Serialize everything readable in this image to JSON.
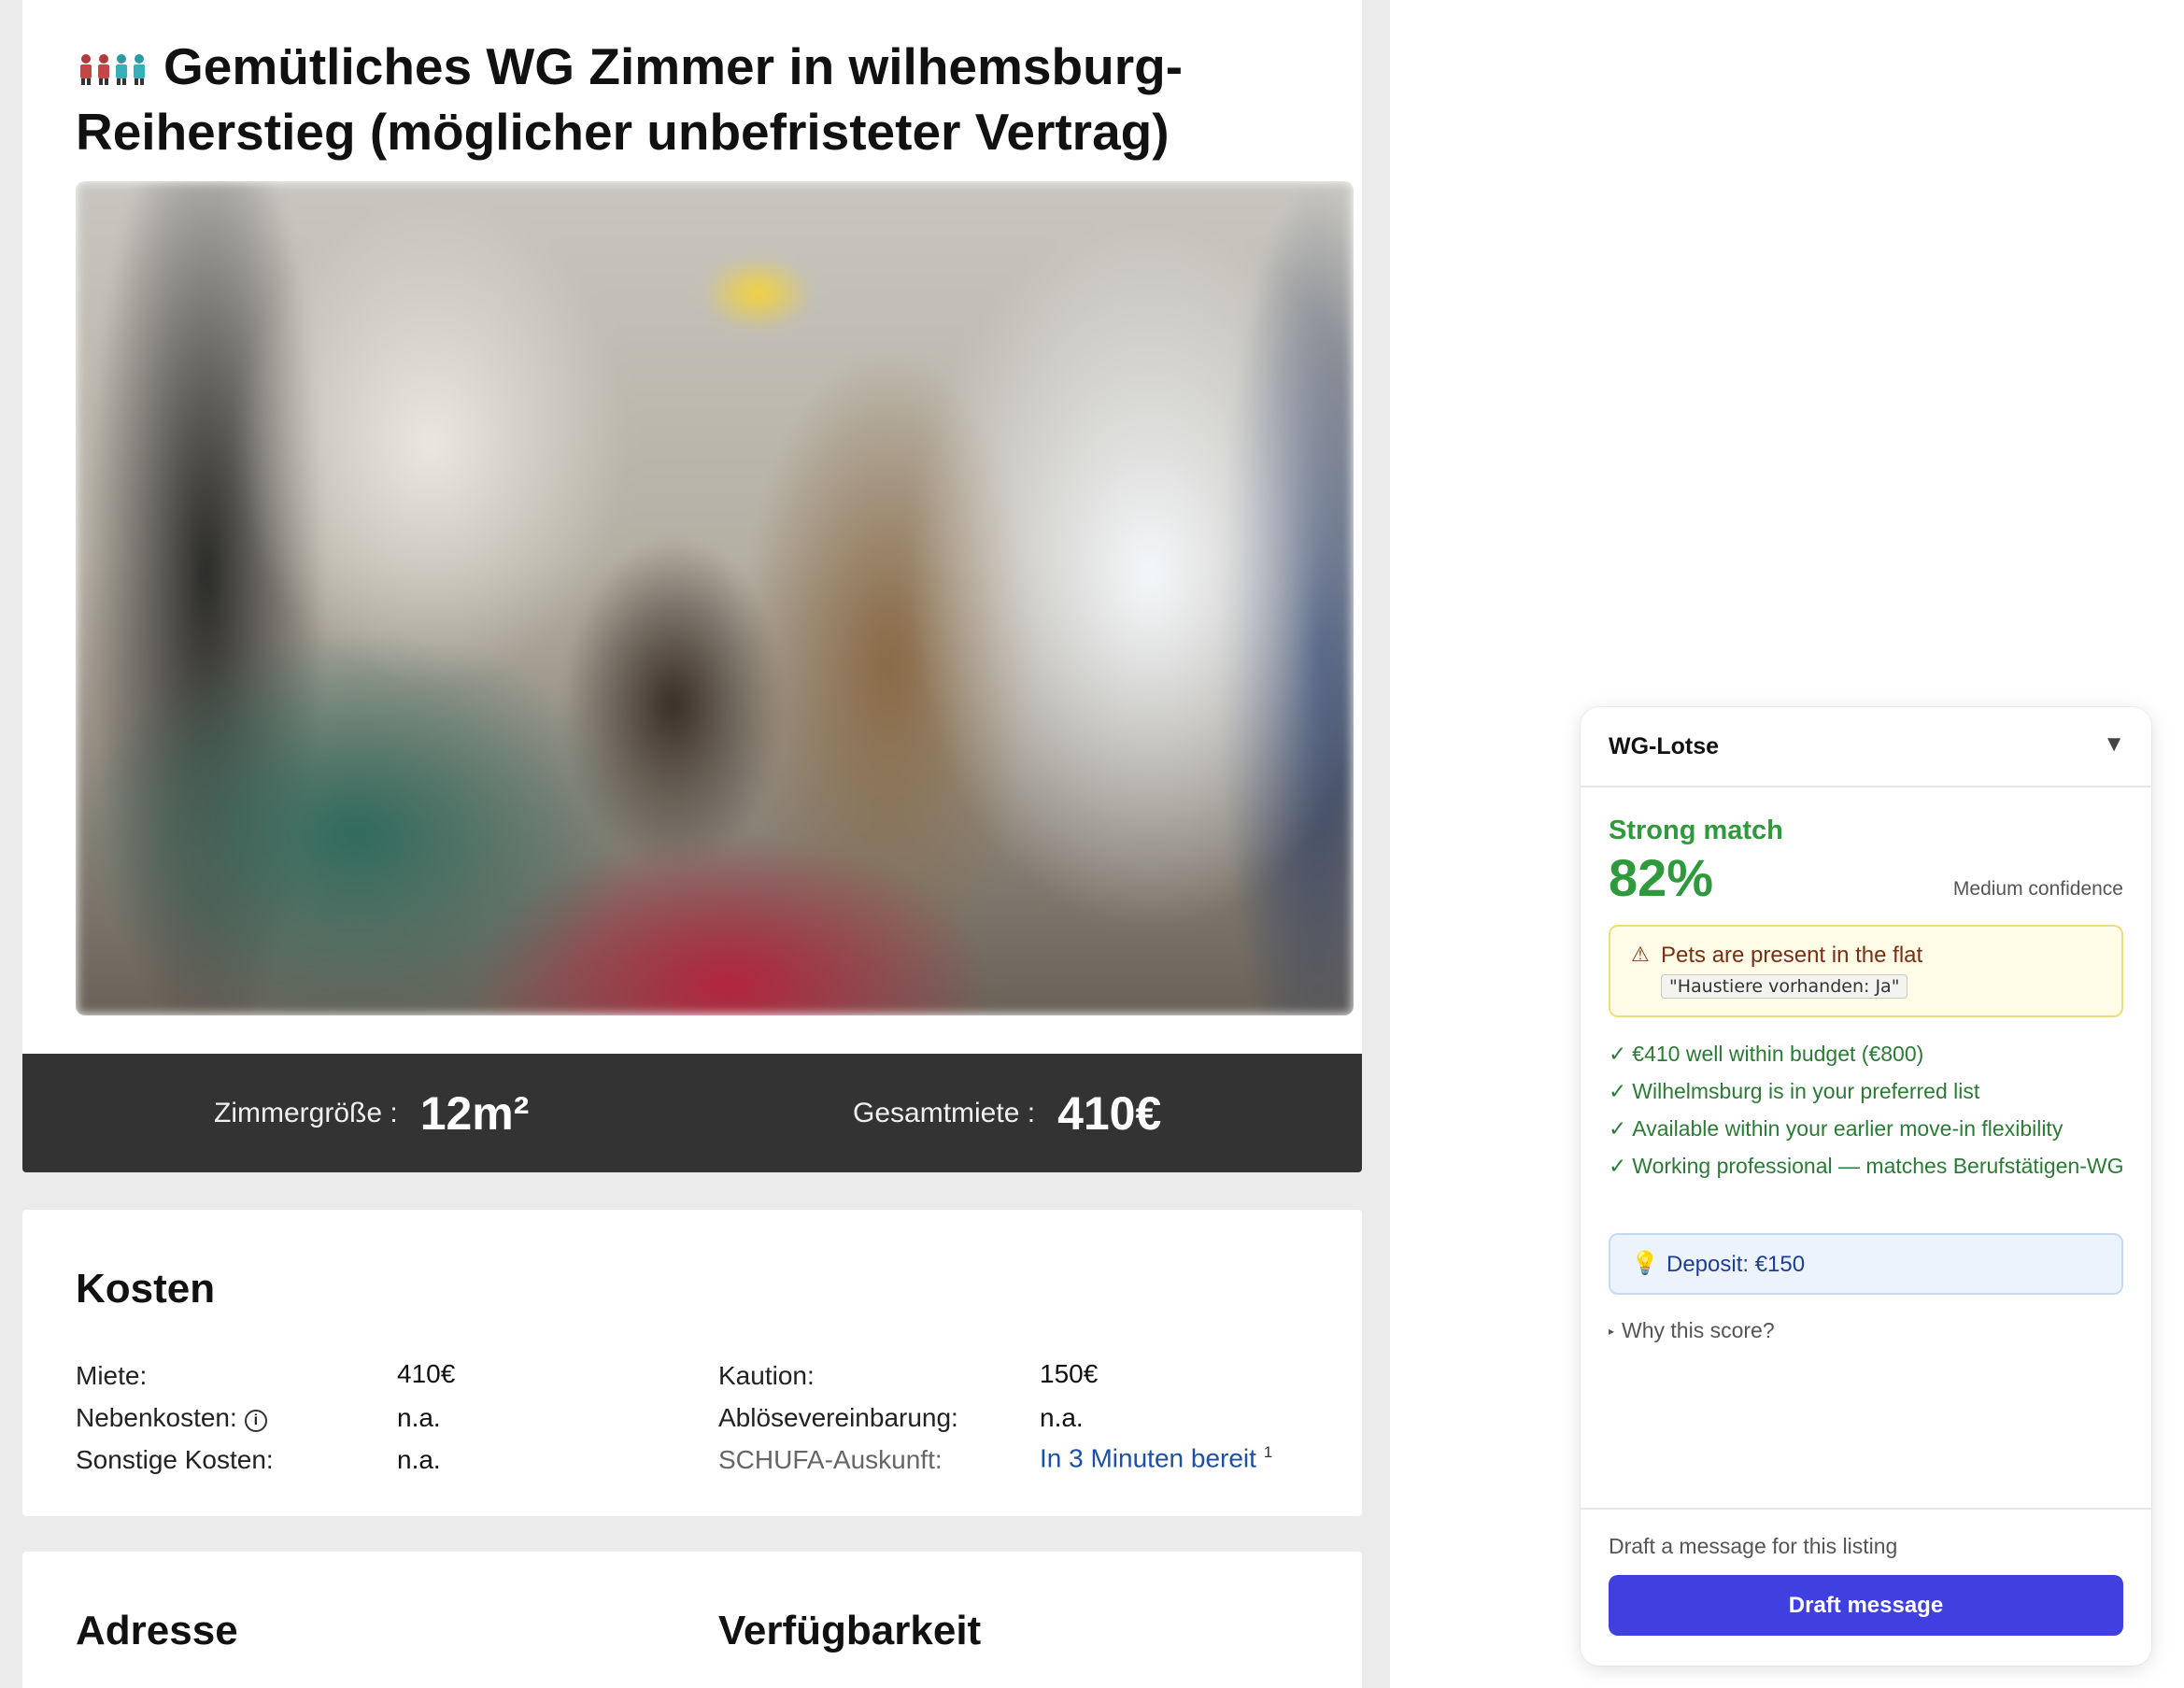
{
  "listing": {
    "title": "Gemütliches WG Zimmer in wilhemsburg-Reiherstieg (möglicher unbefristeter Vertrag)",
    "title_icon": "flatmates-icon",
    "stats": {
      "size_label": "Zimmergröße :",
      "size_value": "12m²",
      "rent_label": "Gesamtmiete :",
      "rent_value": "410€"
    },
    "costs": {
      "heading": "Kosten",
      "miete_label": "Miete:",
      "miete_value": "410€",
      "nebenkosten_label": "Nebenkosten:",
      "nebenkosten_value": "n.a.",
      "sonstige_label": "Sonstige Kosten:",
      "sonstige_value": "n.a.",
      "kaution_label": "Kaution:",
      "kaution_value": "150€",
      "abloese_label": "Ablösevereinbarung:",
      "abloese_value": "n.a.",
      "schufa_label": "SCHUFA-Auskunft:",
      "schufa_link": "In 3 Minuten bereit",
      "schufa_footnote": "1"
    },
    "address_heading": "Adresse",
    "availability_heading": "Verfügbarkeit"
  },
  "assistant": {
    "title": "WG-Lotse",
    "collapse_glyph": "▼",
    "match_label": "Strong match",
    "match_score": "82%",
    "confidence": "Medium confidence",
    "warning": {
      "icon": "warning-icon",
      "text": "Pets are present in the flat",
      "quote": "\"Haustiere vorhanden: Ja\""
    },
    "checks": [
      "€410 well within budget (€800)",
      "Wilhelmsburg is in your preferred list",
      "Available within your earlier move-in flexibility",
      "Working professional — matches Berufstätigen-WG"
    ],
    "tip": {
      "icon": "lightbulb-icon",
      "text": "Deposit: €150"
    },
    "why_label": "Why this score?",
    "footer_label": "Draft a message for this listing",
    "draft_button": "Draft message"
  },
  "colors": {
    "match_green": "#2e9a3c",
    "primary_button": "#4040e0",
    "stats_bar": "#333333",
    "link_blue": "#1d4fa3"
  }
}
